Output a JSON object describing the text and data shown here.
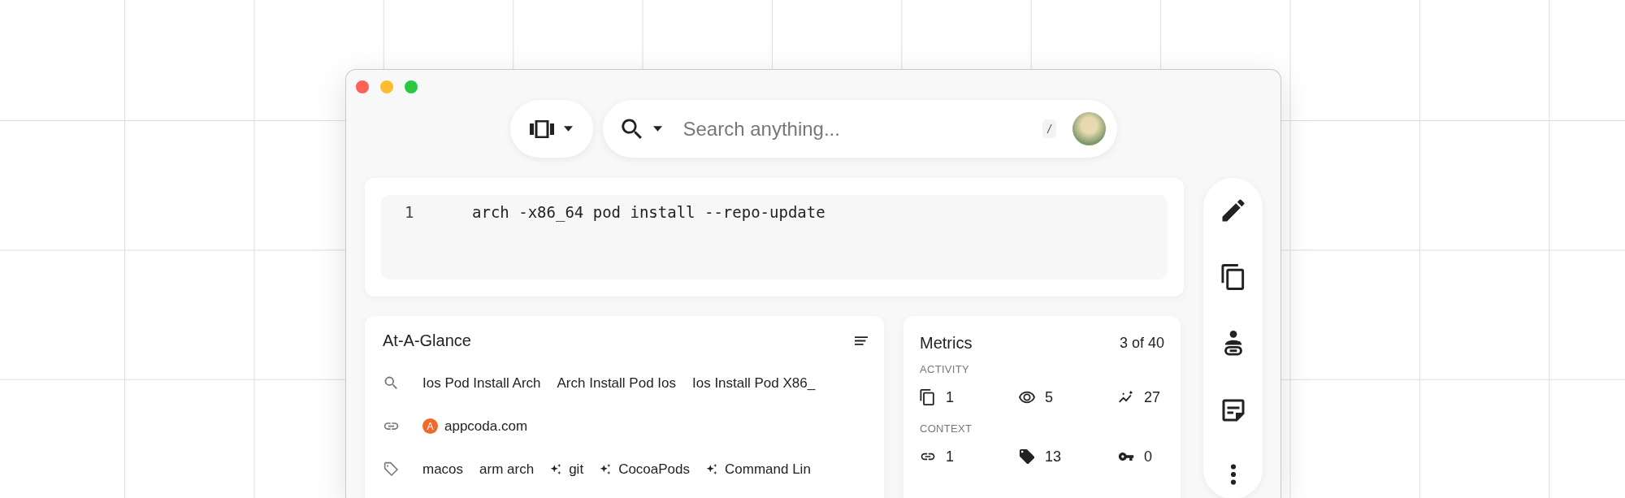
{
  "toolbar": {
    "search": {
      "placeholder": "Search anything...",
      "shortcut": "/"
    }
  },
  "code": {
    "lines": [
      {
        "number": "1",
        "text": "arch -x86_64 pod install --repo-update"
      }
    ]
  },
  "glance": {
    "title": "At-A-Glance",
    "rows": [
      {
        "kind": "search",
        "items": [
          {
            "kind": "plain",
            "text": "Ios Pod Install Arch"
          },
          {
            "kind": "plain",
            "text": "Arch Install Pod Ios"
          },
          {
            "kind": "plain",
            "text": "Ios Install Pod X86_"
          }
        ]
      },
      {
        "kind": "link",
        "items": [
          {
            "kind": "site",
            "favicon": "A",
            "text": "appcoda.com"
          }
        ]
      },
      {
        "kind": "tags",
        "items": [
          {
            "kind": "plain",
            "text": "macos"
          },
          {
            "kind": "plain",
            "text": "arm arch"
          },
          {
            "kind": "suggested",
            "text": "git"
          },
          {
            "kind": "suggested",
            "text": "CocoaPods"
          },
          {
            "kind": "suggested",
            "text": "Command Lin"
          }
        ]
      }
    ]
  },
  "metrics": {
    "title": "Metrics",
    "count": "3 of 40",
    "sections": [
      {
        "label": "ACTIVITY",
        "items": [
          {
            "kind": "copies",
            "value": "1"
          },
          {
            "kind": "views",
            "value": "5"
          },
          {
            "kind": "trend",
            "value": "27"
          }
        ]
      },
      {
        "label": "CONTEXT",
        "items": [
          {
            "kind": "links",
            "value": "1"
          },
          {
            "kind": "tags",
            "value": "13"
          },
          {
            "kind": "keys",
            "value": "0"
          }
        ]
      }
    ]
  }
}
